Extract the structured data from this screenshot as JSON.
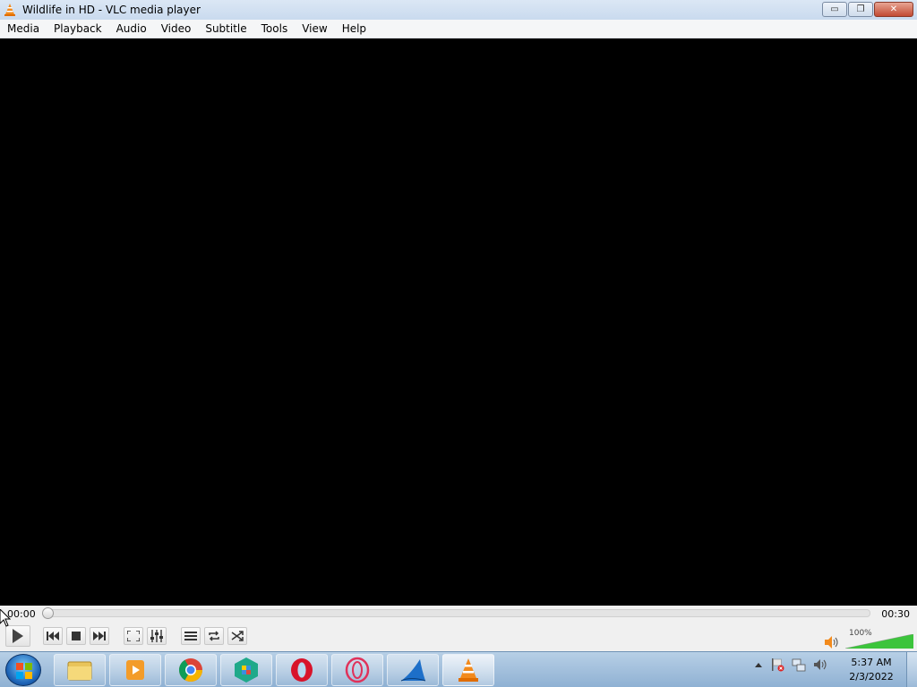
{
  "window": {
    "title": "Wildlife in HD - VLC media player",
    "buttons": {
      "minimize": "▭",
      "restore": "❐",
      "close": "✕"
    }
  },
  "menu": [
    "Media",
    "Playback",
    "Audio",
    "Video",
    "Subtitle",
    "Tools",
    "View",
    "Help"
  ],
  "player": {
    "time_current": "00:00",
    "time_total": "00:30",
    "seek_progress": 0,
    "volume_label": "100%",
    "volume_level": 1.0
  },
  "controls": [
    "play-icon",
    "previous-icon",
    "stop-icon",
    "next-icon",
    "fullscreen-icon",
    "extended-settings-icon",
    "playlist-icon",
    "loop-icon",
    "shuffle-icon"
  ],
  "taskbar": {
    "apps": [
      "windows-explorer-icon",
      "windows-media-player-icon",
      "chrome-icon",
      "app-store-icon",
      "opera-icon",
      "opera-gx-icon",
      "wireshark-icon",
      "vlc-icon"
    ],
    "clock_time": "5:37 AM",
    "clock_date": "2/3/2022"
  },
  "colors": {
    "accent_orange": "#f28a1c",
    "volume_green": "#3cc43c",
    "taskbar": "#a7c3e0"
  }
}
